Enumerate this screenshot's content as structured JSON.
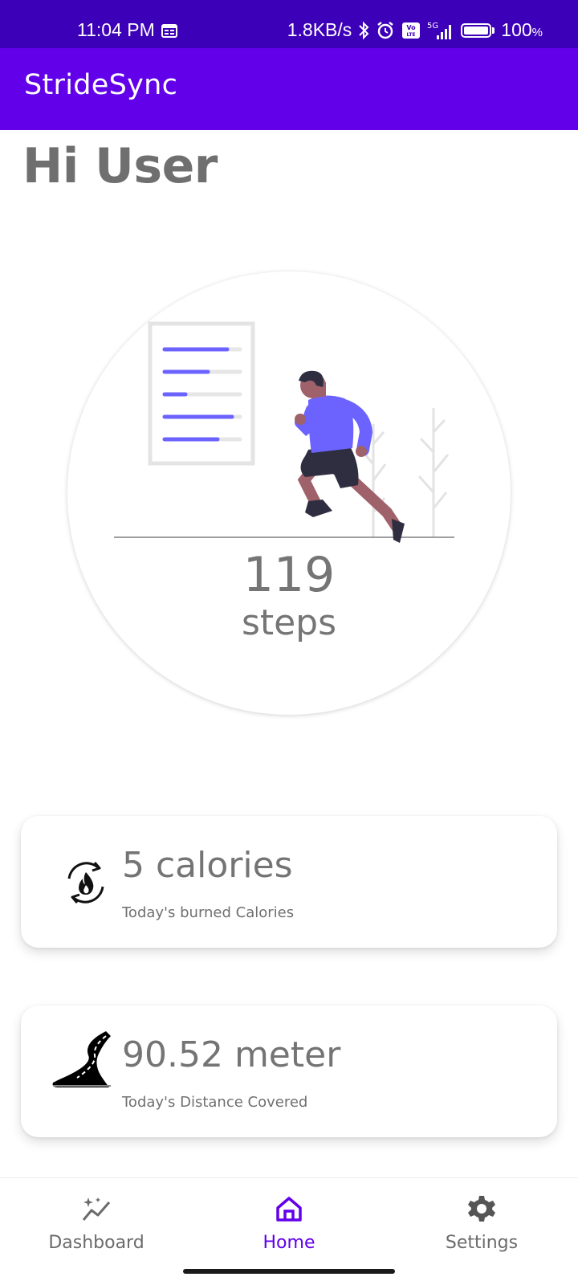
{
  "status_bar": {
    "time": "11:04 PM",
    "network_speed": "1.8KB/s",
    "network_type": "5G",
    "battery_percent": "100",
    "battery_symbol": "%",
    "icons": [
      "calendar-icon",
      "bluetooth-icon",
      "alarm-icon",
      "volte-icon",
      "signal-icon",
      "battery-icon"
    ]
  },
  "app_bar": {
    "title": "StrideSync"
  },
  "greeting": "Hi User",
  "steps": {
    "count": "119",
    "unit": "steps"
  },
  "cards": {
    "calories": {
      "value": "5 calories",
      "subtitle": "Today's burned Calories",
      "icon": "fire-cycle-icon"
    },
    "distance": {
      "value": "90.52 meter",
      "subtitle": "Today's Distance Covered",
      "icon": "road-icon"
    }
  },
  "bottom_nav": {
    "items": [
      {
        "label": "Dashboard",
        "icon": "sparkle-chart-icon",
        "active": false
      },
      {
        "label": "Home",
        "icon": "home-icon",
        "active": true
      },
      {
        "label": "Settings",
        "icon": "gear-icon",
        "active": false
      }
    ]
  },
  "colors": {
    "status_bar": "#3c00b8",
    "app_bar": "#6200ea",
    "accent": "#6200ea",
    "illustration_accent": "#6c63ff",
    "text_gray": "#757575"
  }
}
